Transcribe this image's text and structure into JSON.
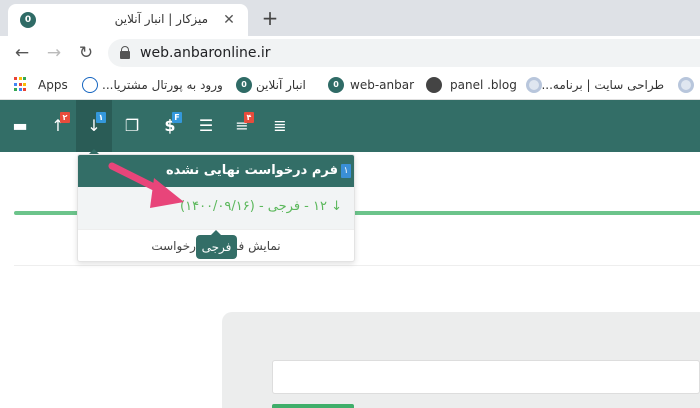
{
  "browser": {
    "tab": {
      "favicon_text": "0",
      "title": "میزکار | انبار آنلاین",
      "close_glyph": "✕"
    },
    "new_tab_glyph": "+",
    "nav": {
      "back": "←",
      "forward": "→",
      "reload": "↻"
    },
    "url": "web.anbaronline.ir"
  },
  "bookmarks": [
    {
      "label": "Apps"
    },
    {
      "label": "ورود به پورتال مشتریا..."
    },
    {
      "label": "انبار آنلاین"
    },
    {
      "label": "web-anbar"
    },
    {
      "label": "panel .blog"
    },
    {
      "label": "طراحی سایت | برنامه..."
    }
  ],
  "appbar": {
    "icons": [
      {
        "name": "warehouse-icon",
        "glyph": "▬"
      },
      {
        "name": "upload-arrow-icon",
        "glyph": "↑",
        "badge": "۲"
      },
      {
        "name": "download-arrow-icon",
        "glyph": "↓",
        "badge": "۱"
      },
      {
        "name": "copy-icon",
        "glyph": "❐"
      },
      {
        "name": "dollar-icon",
        "glyph": "$",
        "badge": "F"
      },
      {
        "name": "list-icon",
        "glyph": "☰"
      },
      {
        "name": "sort-icon",
        "glyph": "≡",
        "badge": "۴"
      },
      {
        "name": "bars-icon",
        "glyph": "≣"
      }
    ]
  },
  "dropdown": {
    "header": "فرم درخواست نهایی نشده",
    "header_badge": "۱",
    "item": "↓ ۱۲ - فرجی - (۱۴۰۰/۰۹/۱۶)",
    "footer": "نمایش فرم‌های درخواست"
  },
  "tooltip": "فرجی",
  "colors": {
    "brand": "#336e67",
    "accent_green": "#5cb85c",
    "badge_red": "#e74c3c",
    "badge_blue": "#3498db",
    "annotation_arrow": "#e8457a"
  }
}
